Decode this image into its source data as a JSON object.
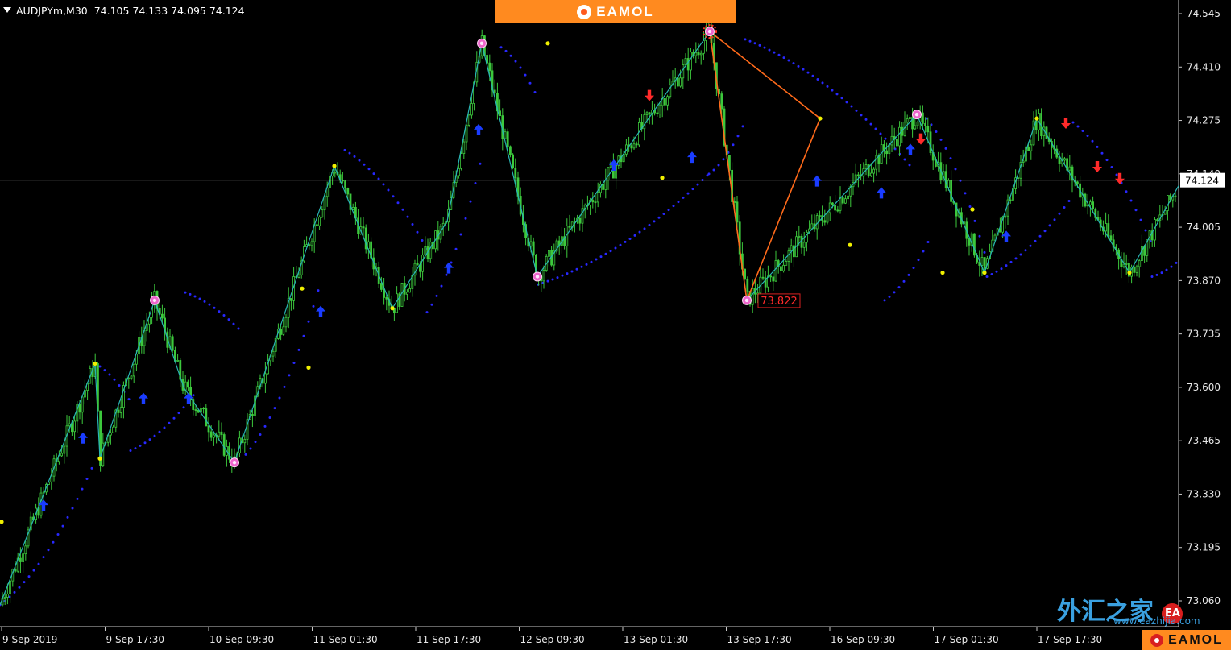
{
  "header": {
    "symbol": "AUDJPYm,M30",
    "ohlc": "74.105 74.133 74.095 74.124"
  },
  "brand": {
    "top": "EAMOL",
    "bottom": "EAMOL"
  },
  "watermark": {
    "text": "外汇之家",
    "badge": "EA",
    "url": "www.eazhijia.com"
  },
  "chart_data": {
    "type": "candlestick",
    "symbol": "AUDJPYm",
    "timeframe": "M30",
    "ylim": [
      73.0,
      74.6
    ],
    "y_ticks": [
      "74.545",
      "74.410",
      "74.275",
      "74.140",
      "74.005",
      "73.870",
      "73.735",
      "73.600",
      "73.465",
      "73.330",
      "73.195",
      "73.060"
    ],
    "x_ticks": [
      "9 Sep 2019",
      "9 Sep 17:30",
      "10 Sep 09:30",
      "11 Sep 01:30",
      "11 Sep 17:30",
      "12 Sep 09:30",
      "13 Sep 01:30",
      "13 Sep 17:30",
      "16 Sep 09:30",
      "17 Sep 01:30",
      "17 Sep 17:30"
    ],
    "current_price": 74.124,
    "current_price_label": "74.124",
    "zigzag_low_label": "73.822",
    "colors": {
      "background": "#000000",
      "candle": "#3cc83c",
      "zigzag": "#28b4b4",
      "pattern": "#ff6a1a",
      "sar": "#2828ff",
      "buy_arrow": "#1a3cff",
      "sell_arrow": "#ff2a2a"
    },
    "zigzag": [
      {
        "x": 0,
        "y": 73.05
      },
      {
        "x": 118,
        "y": 73.66
      },
      {
        "x": 124,
        "y": 73.42
      },
      {
        "x": 192,
        "y": 73.82
      },
      {
        "x": 228,
        "y": 73.6
      },
      {
        "x": 291,
        "y": 73.41
      },
      {
        "x": 415,
        "y": 74.16
      },
      {
        "x": 487,
        "y": 73.8
      },
      {
        "x": 555,
        "y": 74.02
      },
      {
        "x": 598,
        "y": 74.47
      },
      {
        "x": 667,
        "y": 73.88
      },
      {
        "x": 881,
        "y": 74.5
      },
      {
        "x": 927,
        "y": 73.82
      },
      {
        "x": 1138,
        "y": 74.29
      },
      {
        "x": 1222,
        "y": 73.89
      },
      {
        "x": 1287,
        "y": 74.28
      },
      {
        "x": 1402,
        "y": 73.89
      },
      {
        "x": 1463,
        "y": 74.11
      }
    ],
    "pattern": [
      {
        "x": 881,
        "y": 74.5
      },
      {
        "x": 1018,
        "y": 74.28
      },
      {
        "x": 927,
        "y": 73.82
      },
      {
        "x": 881,
        "y": 74.5
      }
    ],
    "pivots_major": [
      {
        "x": 192,
        "y": 73.82
      },
      {
        "x": 291,
        "y": 73.41
      },
      {
        "x": 598,
        "y": 74.47
      },
      {
        "x": 667,
        "y": 73.88
      },
      {
        "x": 881,
        "y": 74.5
      },
      {
        "x": 927,
        "y": 73.82
      },
      {
        "x": 1138,
        "y": 74.29
      }
    ],
    "pivots_minor": [
      {
        "x": 2,
        "y": 73.26
      },
      {
        "x": 118,
        "y": 73.66
      },
      {
        "x": 124,
        "y": 73.42
      },
      {
        "x": 383,
        "y": 73.65
      },
      {
        "x": 375,
        "y": 73.85
      },
      {
        "x": 415,
        "y": 74.16
      },
      {
        "x": 487,
        "y": 73.8
      },
      {
        "x": 680,
        "y": 74.47
      },
      {
        "x": 822,
        "y": 74.13
      },
      {
        "x": 1018,
        "y": 74.28
      },
      {
        "x": 1055,
        "y": 73.96
      },
      {
        "x": 1170,
        "y": 73.89
      },
      {
        "x": 1207,
        "y": 74.05
      },
      {
        "x": 1222,
        "y": 73.89
      },
      {
        "x": 1287,
        "y": 74.28
      },
      {
        "x": 1402,
        "y": 73.89
      }
    ],
    "buy_arrows": [
      {
        "x": 54,
        "y": 73.3
      },
      {
        "x": 103,
        "y": 73.47
      },
      {
        "x": 178,
        "y": 73.57
      },
      {
        "x": 234,
        "y": 73.57
      },
      {
        "x": 398,
        "y": 73.79
      },
      {
        "x": 557,
        "y": 73.9
      },
      {
        "x": 594,
        "y": 74.25
      },
      {
        "x": 762,
        "y": 74.16
      },
      {
        "x": 859,
        "y": 74.18
      },
      {
        "x": 1014,
        "y": 74.12
      },
      {
        "x": 1094,
        "y": 74.09
      },
      {
        "x": 1130,
        "y": 74.2
      },
      {
        "x": 1249,
        "y": 73.98
      }
    ],
    "sell_arrows": [
      {
        "x": 806,
        "y": 74.34
      },
      {
        "x": 1143,
        "y": 74.23
      },
      {
        "x": 1323,
        "y": 74.27
      },
      {
        "x": 1362,
        "y": 74.16
      },
      {
        "x": 1390,
        "y": 74.13
      }
    ],
    "sar_segments": [
      {
        "x0": 0,
        "x1": 115,
        "y0": 73.05,
        "y1": 73.4
      },
      {
        "x0": 118,
        "x1": 160,
        "y0": 73.66,
        "y1": 73.57
      },
      {
        "x0": 162,
        "x1": 240,
        "y0": 73.44,
        "y1": 73.58
      },
      {
        "x0": 230,
        "x1": 300,
        "y0": 73.84,
        "y1": 73.74
      },
      {
        "x0": 305,
        "x1": 400,
        "y0": 73.43,
        "y1": 73.88
      },
      {
        "x0": 428,
        "x1": 530,
        "y0": 74.2,
        "y1": 73.95
      },
      {
        "x0": 530,
        "x1": 600,
        "y0": 73.79,
        "y1": 74.2
      },
      {
        "x0": 622,
        "x1": 668,
        "y0": 74.46,
        "y1": 74.33
      },
      {
        "x0": 668,
        "x1": 880,
        "y0": 73.86,
        "y1": 74.14
      },
      {
        "x0": 880,
        "x1": 922,
        "y0": 74.14,
        "y1": 74.26
      },
      {
        "x0": 925,
        "x1": 1130,
        "y0": 74.48,
        "y1": 74.16
      },
      {
        "x0": 1098,
        "x1": 1155,
        "y0": 73.82,
        "y1": 73.98
      },
      {
        "x0": 1150,
        "x1": 1225,
        "y0": 74.28,
        "y1": 73.92
      },
      {
        "x0": 1225,
        "x1": 1330,
        "y0": 73.88,
        "y1": 74.08
      },
      {
        "x0": 1332,
        "x1": 1430,
        "y0": 74.27,
        "y1": 73.96
      },
      {
        "x0": 1430,
        "x1": 1463,
        "y0": 73.88,
        "y1": 73.92
      }
    ]
  }
}
